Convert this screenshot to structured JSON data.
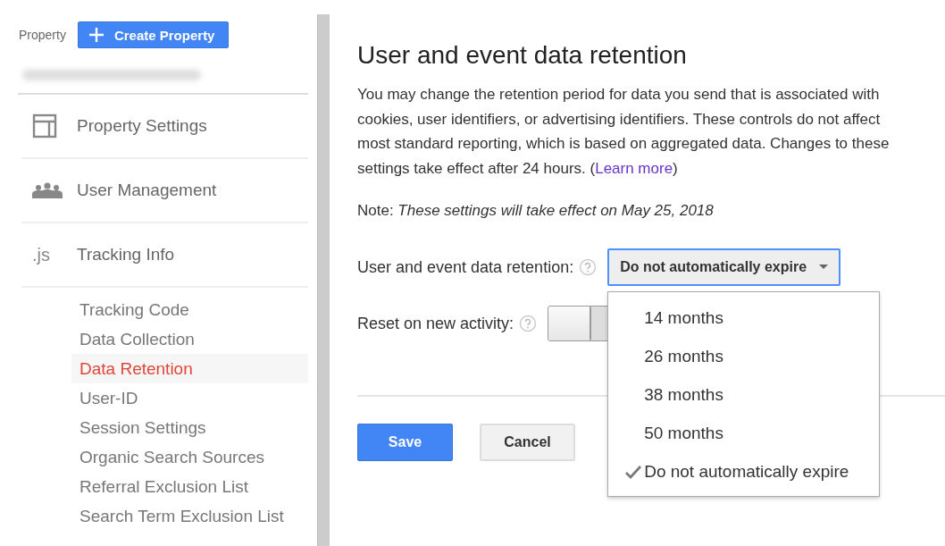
{
  "sidebar": {
    "label": "Property",
    "create_button": "Create Property",
    "sections": [
      {
        "kind": "layout",
        "label": "Property Settings"
      },
      {
        "kind": "people",
        "label": "User Management"
      },
      {
        "kind": "js",
        "label": "Tracking Info",
        "icon_text": ".js",
        "expanded": true,
        "children": [
          {
            "label": "Tracking Code",
            "selected": false
          },
          {
            "label": "Data Collection",
            "selected": false
          },
          {
            "label": "Data Retention",
            "selected": true
          },
          {
            "label": "User-ID",
            "selected": false
          },
          {
            "label": "Session Settings",
            "selected": false
          },
          {
            "label": "Organic Search Sources",
            "selected": false
          },
          {
            "label": "Referral Exclusion List",
            "selected": false
          },
          {
            "label": "Search Term Exclusion List",
            "selected": false
          }
        ]
      }
    ]
  },
  "main": {
    "title": "User and event data retention",
    "description": "You may change the retention period for data you send that is associated with cookies, user identifiers, or advertising identifiers. These controls do not affect most standard reporting, which is based on aggregated data. Changes to these settings take effect after 24 hours. (",
    "link": "Learn more",
    "description_end": ")",
    "note_label": "Note:",
    "note": "These settings will take effect on May 25, 2018",
    "retention_label": "User and event data retention:",
    "retention_value": "Do not automatically expire",
    "reset_label": "Reset on new activity:",
    "reset_on": false,
    "dropdown_open": true,
    "options": [
      {
        "label": "14 months",
        "selected": false
      },
      {
        "label": "26 months",
        "selected": false
      },
      {
        "label": "38 months",
        "selected": false
      },
      {
        "label": "50 months",
        "selected": false
      },
      {
        "label": "Do not automatically expire",
        "selected": true
      }
    ],
    "buttons": [
      {
        "kind": "primary",
        "label": "Save"
      },
      {
        "kind": "secondary",
        "label": "Cancel"
      }
    ]
  }
}
